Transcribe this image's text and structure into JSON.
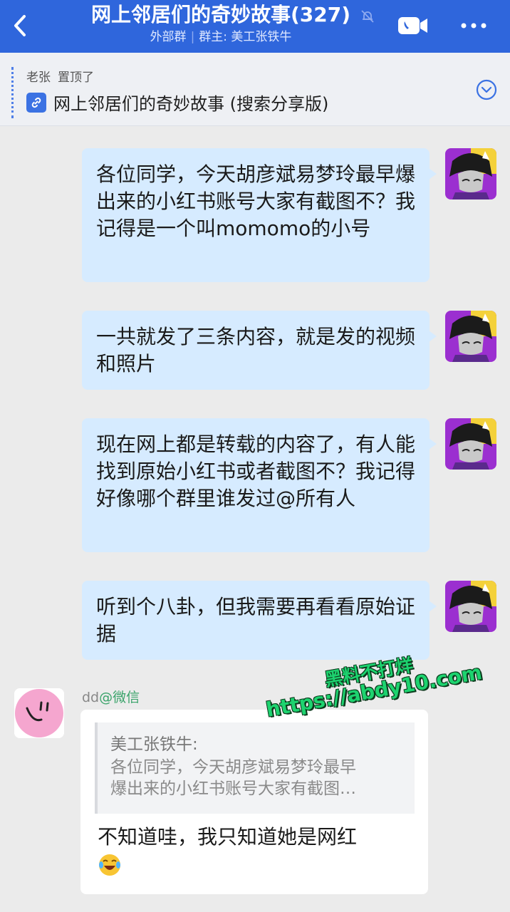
{
  "header": {
    "title": "网上邻居们的奇妙故事(327)",
    "subtitle_type": "外部群",
    "subtitle_owner": "群主: 美工张铁牛",
    "bg_color": "#2f66dc"
  },
  "pinned": {
    "author": "老张",
    "action": "置顶了",
    "title": "网上邻居们的奇妙故事 (搜索分享版)"
  },
  "messages": [
    {
      "text": "各位同学，今天胡彦斌易梦玲最早爆出来的小红书账号大家有截图不？我记得是一个叫momomo的小号"
    },
    {
      "text": "一共就发了三条内容，就是发的视频和照片"
    },
    {
      "text": "现在网上都是转载的内容了，有人能找到原始小红书或者截图不？我记得好像哪个群里谁发过@所有人"
    },
    {
      "text": "听到个八卦，但我需要再看看原始证据"
    }
  ],
  "reply": {
    "sender": "dd",
    "sender_app": "@微信",
    "quote_author": "美工张铁牛:",
    "quote_line1": "各位同学，今天胡彦斌易梦玲最早",
    "quote_line2": "爆出来的小红书账号大家有截图…",
    "text": "不知道哇，我只知道她是网红"
  },
  "watermark": {
    "line1": "黑料不打烊",
    "line2": "https://abdy10.com"
  },
  "icons": {
    "back": "back-arrow-icon",
    "mute": "mute-bell-icon",
    "video": "video-call-icon",
    "more": "more-dots-icon",
    "link": "link-icon",
    "expand": "expand-chevron-icon",
    "emoji": "laughing-crying-emoji"
  }
}
